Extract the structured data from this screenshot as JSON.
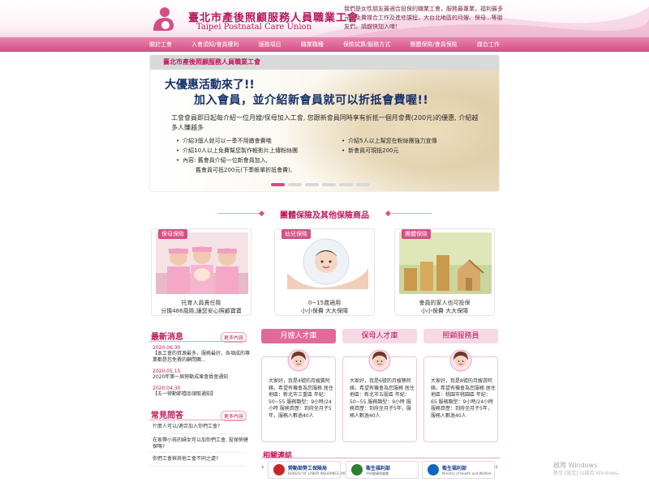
{
  "header": {
    "title_cn": "臺北市產後照顧服務人員職業工會",
    "title_en": "Taipei Postnatal Care Union",
    "description": "我們是女性朋友最適合投保的職業工會，服務最專業，福利最多元，免費媒合工作及進修課程，大台北地區的月嫂、保母...等朋友們，請趕快加入唷！"
  },
  "nav": {
    "items": [
      "關於工會",
      "入會須知/會員權利",
      "服務項目",
      "職業職種",
      "保險試算/服務方式",
      "團體保險/會員保險",
      "媒合工作"
    ]
  },
  "banner": {
    "top_label": "臺北市產後照顧服務人員職業工會",
    "headline1": "大優惠活動來了!!",
    "headline2": "加入會員，並介紹新會員就可以折抵會費喔!!",
    "paragraph": "工會會員即日起每介紹一位月嫂/保母加入工會, 您跟新會員同時享有折抵一個月會費(200元)的優惠, 介紹越多人賺越多",
    "left_items": [
      "介紹3個人就可以一季不用繳會費哦",
      "介紹10人以上免費幫您製作輕影片上傳粉絲團",
      "內容: 舊會員介紹一位新會員加入,",
      "舊會員可抵200元(下季帳單折抵會費),"
    ],
    "right_items": [
      "介紹5人以上幫您在粉絲團強力宣傳",
      "新會員可現抵200元"
    ],
    "slide_count": 6,
    "active_slide": 1
  },
  "insurance_section": {
    "title": "團體保險及其他保險商品",
    "cards": [
      {
        "tag": "保母保險",
        "line1": "托育人員責任險",
        "line2": "分擔486風險,讓您安心照顧寶寶"
      },
      {
        "tag": "幼兒保險",
        "line1": "0~15歲適用",
        "line2": "小小保費 大大保障"
      },
      {
        "tag": "團體保險",
        "line1": "會員的家人也可投保",
        "line2": "小小保費 大大保障"
      }
    ]
  },
  "news": {
    "title": "最新消息",
    "more_label": "更多內容",
    "items": [
      {
        "date": "2020.06.30",
        "text": "【本工會的資源最多，服務最好，各項成的專業都是您免費的顧問團..."
      },
      {
        "date": "2020.05.15",
        "text": "2020年第一屆勞動成果會員會通知"
      },
      {
        "date": "2020.04.30",
        "text": "【五一勞動節禮品領取通知】"
      }
    ]
  },
  "faq": {
    "title": "常見問答",
    "more_label": "更多內容",
    "items": [
      "什麼人可以/適合加入你們工會?",
      "在家帶小孩的婦女可以加你們工會, 投保勞健保嗎?",
      "你們工會與其他工會不同之處?"
    ]
  },
  "talent": {
    "tabs": [
      "月嫂人才庫",
      "保母人才庫",
      "照顧服務員"
    ],
    "active_tab": 0,
    "cards": [
      {
        "text": "大家好，我是4號的月嫂黃阿姨，希望有機會為您服務 居住地區：新北市三重區 年紀：50~55 服務類型：9小時/24小時 服務資歷：到府坐月子5年，服務人數逾40人"
      },
      {
        "text": "大家好，我是6號的月嫂蔡阿姨，希望有機會為您服務 居住地區：新北市五股區 年紀：50~55 服務類型：9小時 服務資歷：到府坐月子5年，服務人數逾40人"
      },
      {
        "text": "大家好，我是8號的月嫂游阿姨，希望有機會為您服務 居住地區：桃園市桃園區 年紀：65 服務類型：9小時/24小時 服務資歷：到府坐月子5年，服務人數逾40人"
      }
    ]
  },
  "links": {
    "title": "相關連結",
    "items": [
      {
        "name": "勞動部勞工保險局",
        "sub": "BUREAU OF LABOR INSURANCE, MOL",
        "color": "#c62828"
      },
      {
        "name": "衛生福利部",
        "sub": "中央健康保險署",
        "color": "#2e7d32"
      },
      {
        "name": "衛生福利部",
        "sub": "Ministry of Health and Welfare",
        "color": "#1565c0"
      }
    ]
  },
  "watermark": {
    "line1": "啟用 Windows",
    "line2": "移至 [設定] 以啟用 Windows。"
  }
}
